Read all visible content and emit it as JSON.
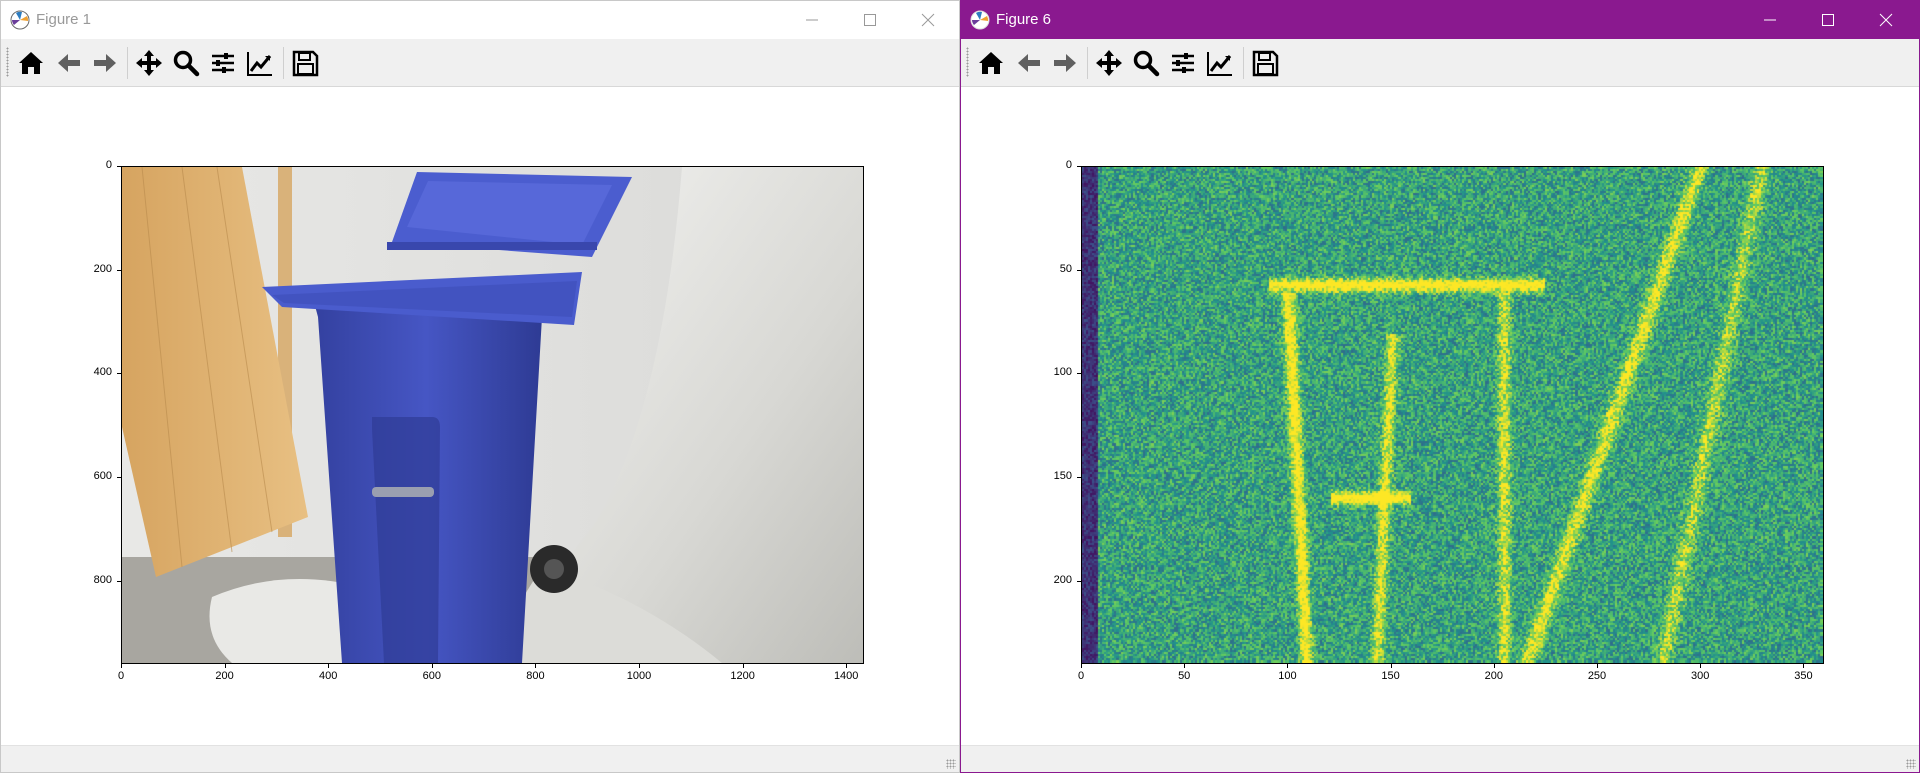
{
  "windows": [
    {
      "title": "Figure 1",
      "image_description_label": "photograph",
      "axes": {
        "x_ticks": [
          "0",
          "200",
          "400",
          "600",
          "800",
          "1000",
          "1200",
          "1400"
        ],
        "y_ticks": [
          "0",
          "200",
          "400",
          "600",
          "800"
        ]
      }
    },
    {
      "title": "Figure 6",
      "axes": {
        "x_ticks": [
          "0",
          "50",
          "100",
          "150",
          "200",
          "250",
          "300",
          "350"
        ],
        "y_ticks": [
          "0",
          "50",
          "100",
          "150",
          "200"
        ]
      }
    }
  ],
  "toolbar_icons": [
    "home-icon",
    "back-icon",
    "forward-icon",
    "pan-icon",
    "zoom-icon",
    "configure-subplots-icon",
    "edit-axis-icon",
    "save-icon"
  ],
  "colors": {
    "active_titlebar": "#8a198f",
    "bin_blue": "#3f4eb8",
    "viridis": [
      "#440154",
      "#3b528b",
      "#21918c",
      "#5ec962",
      "#fde725"
    ]
  }
}
